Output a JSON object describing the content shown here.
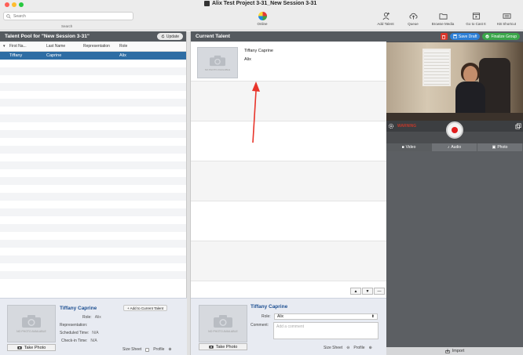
{
  "window": {
    "title": "Alix Test Project 3-31_New Session 3-31"
  },
  "toolbar": {
    "search_placeholder": "Search",
    "search_caption": "Search",
    "online_label": "Online",
    "buttons": [
      {
        "label": "Add Talent",
        "icon": "add-person-icon"
      },
      {
        "label": "Queue",
        "icon": "cloud-upload-icon"
      },
      {
        "label": "Browse Media",
        "icon": "folder-icon"
      },
      {
        "label": "Go to Cast It",
        "icon": "film-icon"
      },
      {
        "label": "KB Shortcut",
        "icon": "keyboard-icon"
      }
    ]
  },
  "talent_pool": {
    "title": "Talent Pool for \"New Session 3-31\"",
    "update_label": "Update",
    "columns": [
      "First Na...",
      "Last Name",
      "Representation",
      "Role"
    ],
    "rows": [
      {
        "first": "Tiffany",
        "last": "Caprine",
        "representation": "",
        "role": "Alix",
        "selected": true
      }
    ]
  },
  "pool_detail": {
    "name": "Tiffany Caprine",
    "no_photo": "NO PHOTO AVAILABLE",
    "take_photo": "Take Photo",
    "add_to_current": "+ Add to Current Talent",
    "fields": [
      {
        "label": "Role:",
        "value": "Alix"
      },
      {
        "label": "Representation:",
        "value": ""
      },
      {
        "label": "Scheduled Time:",
        "value": "N/A"
      },
      {
        "label": "Check-in Time:",
        "value": "N/A"
      }
    ],
    "size_sheet": "Size Sheet",
    "profile": "Profile"
  },
  "current_talent": {
    "title": "Current Talent",
    "card": {
      "name": "Tiffany Caprine",
      "role": "Alix",
      "no_photo": "NO PHOTO AVAILABLE"
    },
    "order_buttons": [
      "▲",
      "▼",
      "—"
    ]
  },
  "current_detail": {
    "name": "Tiffany Caprine",
    "role_label": "Role:",
    "role_value": "Alix",
    "comment_label": "Comment:",
    "comment_placeholder": "Add a comment",
    "take_photo": "Take Photo",
    "no_photo": "NO PHOTO AVAILABLE",
    "size_sheet": "Size Sheet",
    "profile": "Profile"
  },
  "actions": {
    "save_draft": "Save Draft",
    "finalize": "Finalize Group"
  },
  "recorder": {
    "warning": "WARNING",
    "tabs": [
      "Video",
      "Audio",
      "Photo"
    ],
    "import_label": "Import"
  }
}
